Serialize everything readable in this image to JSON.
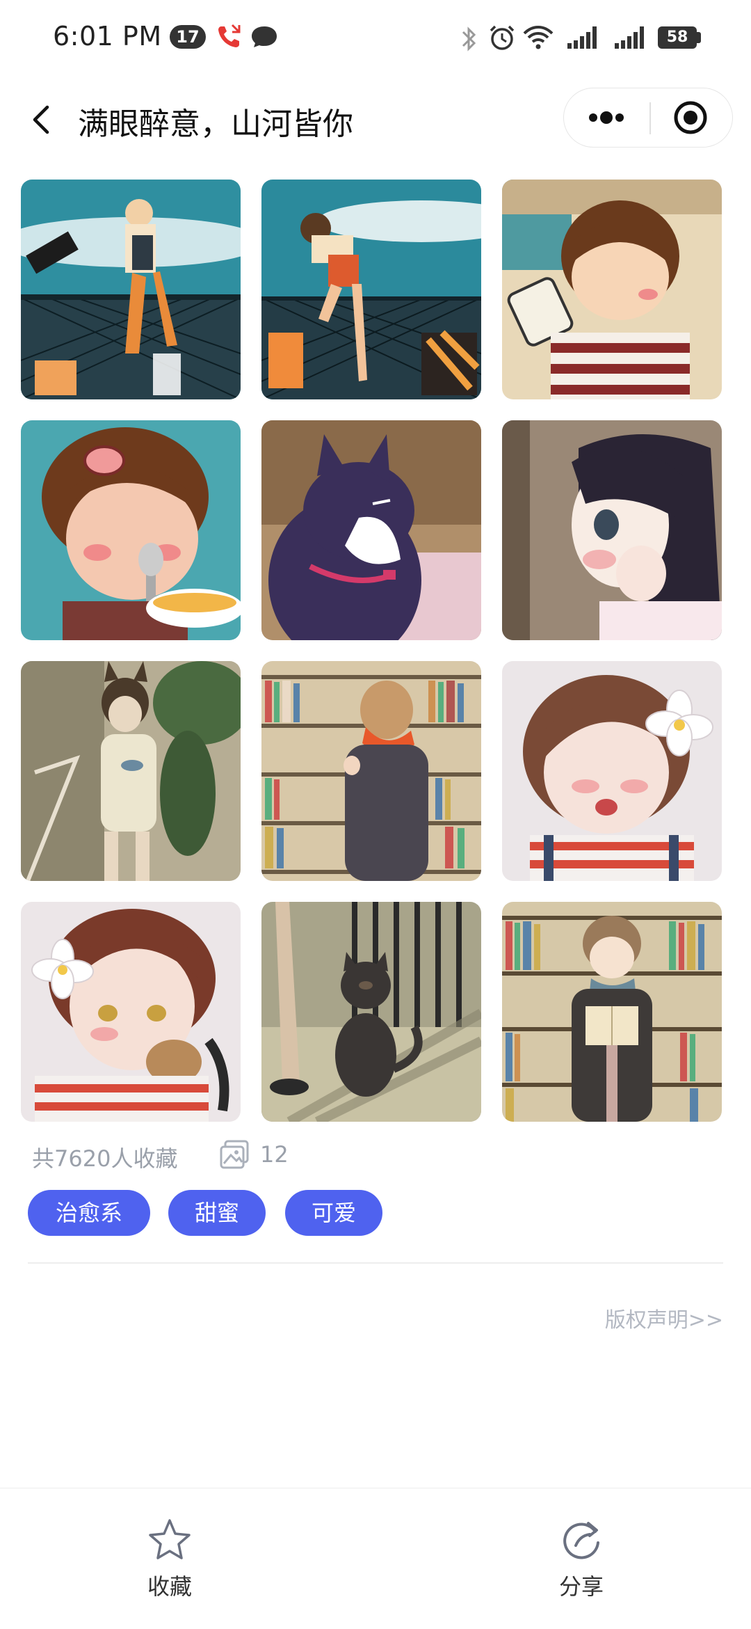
{
  "status_bar": {
    "time": "6:01 PM",
    "notification_count": "17",
    "battery": "58"
  },
  "header": {
    "title": "满眼醉意，山河皆你",
    "back_icon": "chevron-left-icon",
    "more_icon": "more-dots-icon",
    "close_icon": "target-circle-icon"
  },
  "gallery": {
    "images": [
      {
        "label": "airplane-fence-girl"
      },
      {
        "label": "airplane-fence-climbing-girl"
      },
      {
        "label": "boy-drinking-cup"
      },
      {
        "label": "girl-eating-crying"
      },
      {
        "label": "black-white-cat"
      },
      {
        "label": "girl-profile-hands-cheek"
      },
      {
        "label": "cat-ear-girl-yawning"
      },
      {
        "label": "girl-bookshelf-orange-scarf"
      },
      {
        "label": "girl-white-flower-hair"
      },
      {
        "label": "boy-white-flower-hair"
      },
      {
        "label": "black-cat-sunlight"
      },
      {
        "label": "boy-reading-bookshelf"
      }
    ]
  },
  "meta": {
    "fav_text": "共7620人收藏",
    "image_count": "12"
  },
  "tags": [
    "治愈系",
    "甜蜜",
    "可爱"
  ],
  "copyright_link": "版权声明>>",
  "bottom_bar": {
    "favorite_label": "收藏",
    "share_label": "分享"
  },
  "colors": {
    "accent": "#4f62ef",
    "muted_text": "#9aa0aa"
  }
}
